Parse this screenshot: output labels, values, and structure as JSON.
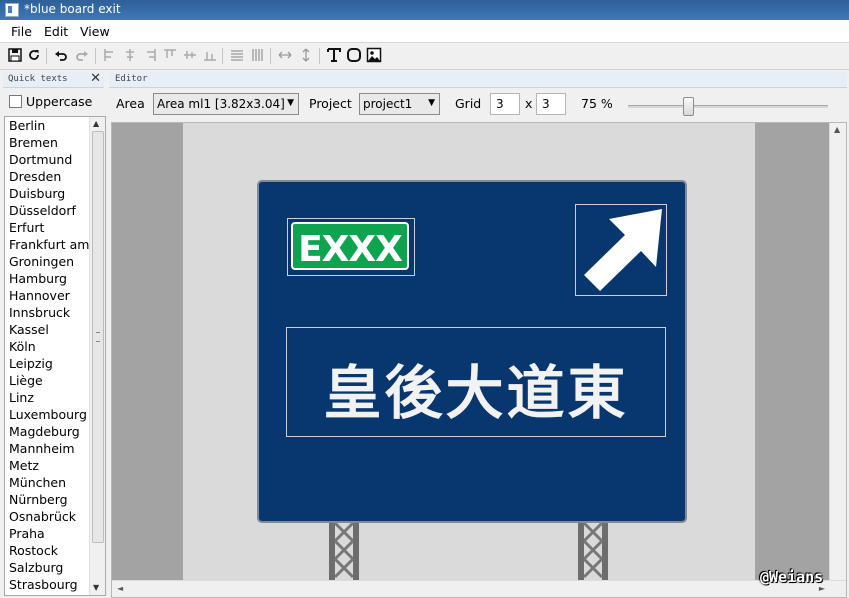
{
  "window": {
    "title": "*blue board exit"
  },
  "menu": [
    "File",
    "Edit",
    "View"
  ],
  "toolbar": {
    "icons": [
      "save-icon",
      "refresh-icon",
      "undo-icon",
      "redo-icon",
      "align-left-icon",
      "align-center-icon",
      "align-right-icon",
      "align-top-icon",
      "align-middle-icon",
      "align-bottom-icon",
      "distribute-horizontal-icon",
      "distribute-vertical-icon",
      "stretch-horizontal-icon",
      "stretch-vertical-icon",
      "text-icon",
      "shape-icon",
      "image-icon"
    ]
  },
  "quick_texts": {
    "title": "Quick texts",
    "uppercase_label": "Uppercase",
    "uppercase_checked": false,
    "cities": [
      "Berlin",
      "Bremen",
      "Dortmund",
      "Dresden",
      "Duisburg",
      "Düsseldorf",
      "Erfurt",
      "Frankfurt am",
      "Groningen",
      "Hamburg",
      "Hannover",
      "Innsbruck",
      "Kassel",
      "Köln",
      "Leipzig",
      "Liège",
      "Linz",
      "Luxembourg",
      "Magdeburg",
      "Mannheim",
      "Metz",
      "München",
      "Nürnberg",
      "Osnabrück",
      "Praha",
      "Rostock",
      "Salzburg",
      "Strasbourg"
    ]
  },
  "editor": {
    "title": "Editor",
    "area_label": "Area",
    "area_value": "Area ml1 [3.82x3.04]",
    "project_label": "Project",
    "project_value": "project1",
    "grid_label": "Grid",
    "grid_x": "3",
    "grid_sep": "x",
    "grid_y": "3",
    "zoom": "75 %",
    "zoom_fraction": 0.3
  },
  "sign": {
    "background_color": "#08366e",
    "exit_badge_color": "#0ea44f",
    "exit_text": "EXXX",
    "destination_text": "皇後大道東",
    "arrow": "arrow-up-right-icon"
  },
  "watermark": "@Weians"
}
